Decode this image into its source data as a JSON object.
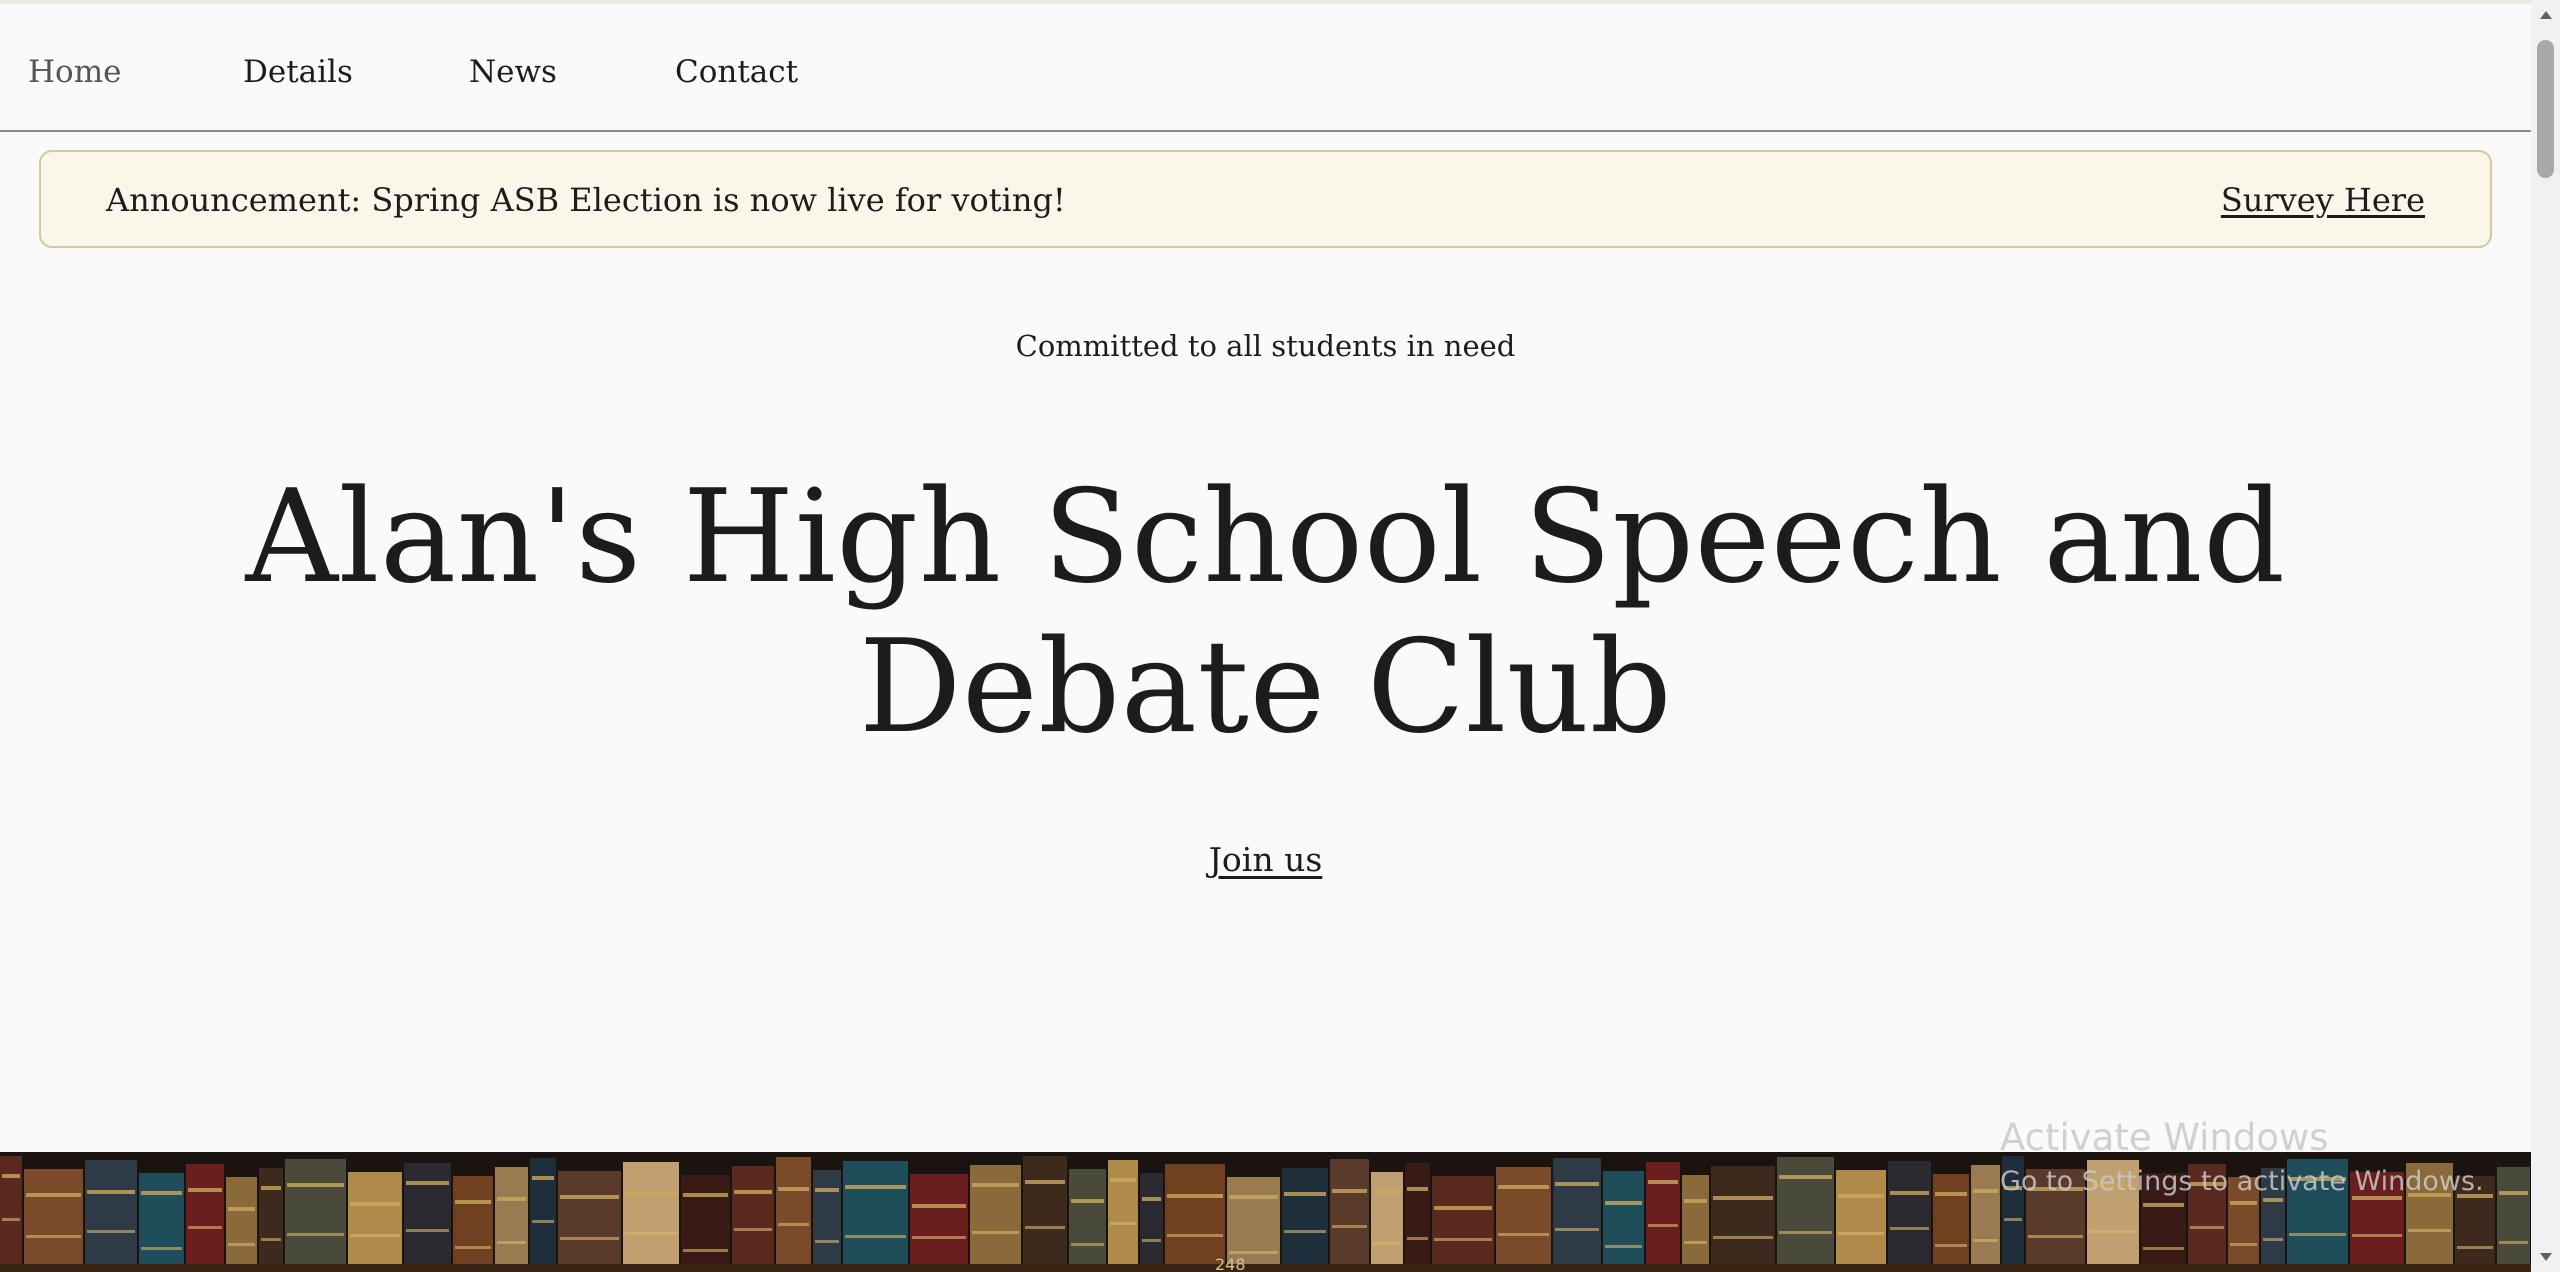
{
  "nav": {
    "items": [
      {
        "label": "Home",
        "active": true
      },
      {
        "label": "Details",
        "active": false
      },
      {
        "label": "News",
        "active": false
      },
      {
        "label": "Contact",
        "active": false
      }
    ]
  },
  "announcement": {
    "text": "Announcement: Spring ASB Election is now live for voting!",
    "link_label": "Survey Here"
  },
  "hero": {
    "tagline": "Committed to all students in need",
    "title": "Alan's High School Speech and Debate Club",
    "cta_label": "Join us"
  },
  "banner": {
    "visible_spine_label": "248"
  },
  "watermark": {
    "title": "Activate Windows",
    "subtitle": "Go to Settings to activate Windows."
  },
  "colors": {
    "page_background": "#fafafa",
    "text": "#1c1c1c",
    "announcement_background": "#fbf6ea",
    "announcement_border": "#d4c89c",
    "nav_divider": "#8a8a8a"
  },
  "icons": {
    "scroll_up": "triangle-up-icon",
    "scroll_down": "triangle-down-icon"
  }
}
